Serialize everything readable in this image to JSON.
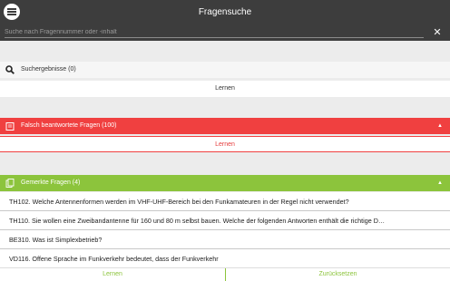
{
  "header": {
    "title": "Fragensuche"
  },
  "search": {
    "placeholder": "Suche nach Fragennummer oder -inhalt",
    "clear_icon": "close-icon"
  },
  "results": {
    "label": "Suchergebnisse (0)",
    "learn_label": "Lernen",
    "icon": "search-icon"
  },
  "wrong": {
    "label": "Falsch beantwortete Fragen (100)",
    "learn_label": "Lernen",
    "color": "#f04040",
    "icon": "clipboard-icon",
    "chevron": "▲"
  },
  "marked": {
    "label": "Gemerkte Fragen (4)",
    "color": "#8cc43c",
    "icon": "bookmark-icon",
    "chevron": "▲",
    "items": [
      "TH102. Welche Antennenformen werden im VHF-UHF-Bereich bei den Funkamateuren in der Regel nicht verwendet?",
      "TH110. Sie wollen eine Zweibandantenne für 160 und 80 m selbst bauen.  Welche der folgenden Antworten enthält die richtige D…",
      "BE310. Was ist Simplexbetrieb?",
      "VD116. Offene Sprache im Funkverkehr bedeutet, dass der Funkverkehr"
    ]
  },
  "bottom": {
    "learn_label": "Lernen",
    "reset_label": "Zurücksetzen"
  }
}
